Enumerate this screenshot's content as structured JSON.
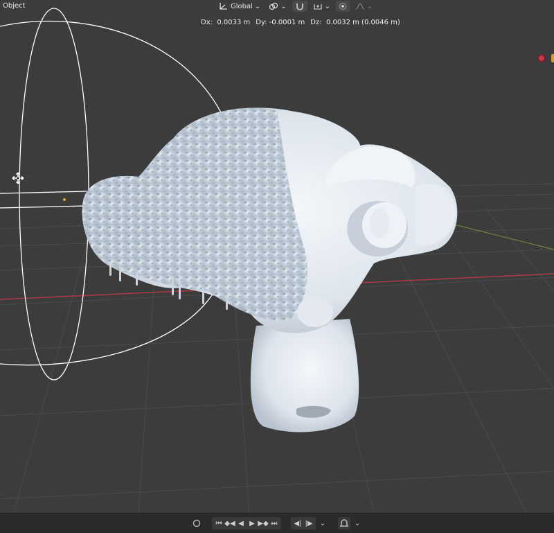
{
  "header": {
    "mode_label": "Object",
    "transform_orientation": "Global"
  },
  "readout": {
    "dx_label": "Dx:",
    "dx_value": "0.0033 m",
    "dy_label": "Dy:",
    "dy_value": "-0.0001 m",
    "dz_label": "Dz:",
    "dz_value": "0.0032 m (0.0046 m)"
  },
  "icons": {
    "orientation": "transform-orientation-icon",
    "pivot": "pivot-point-icon",
    "snap": "snap-magnet-icon",
    "snap_target": "snap-target-icon",
    "proportional": "proportional-edit-icon",
    "falloff": "falloff-icon"
  },
  "colors": {
    "viewport_bg": "#3c3c3c",
    "grid": "#4a4a4a",
    "x_axis": "#b03a48",
    "y_axis": "#7a9a3a",
    "gizmo": "#ffffff",
    "mesh": "#dfe6ee",
    "timeline_bg": "#2b2b2b"
  },
  "timeline": {
    "buttons": [
      "record-button",
      "jump-start-button",
      "prev-keyframe-button",
      "play-reverse-button",
      "play-button",
      "next-keyframe-button",
      "jump-end-button",
      "prev-frame-button",
      "next-frame-button",
      "playback-dropdown",
      "keying-button",
      "keying-dropdown"
    ]
  }
}
